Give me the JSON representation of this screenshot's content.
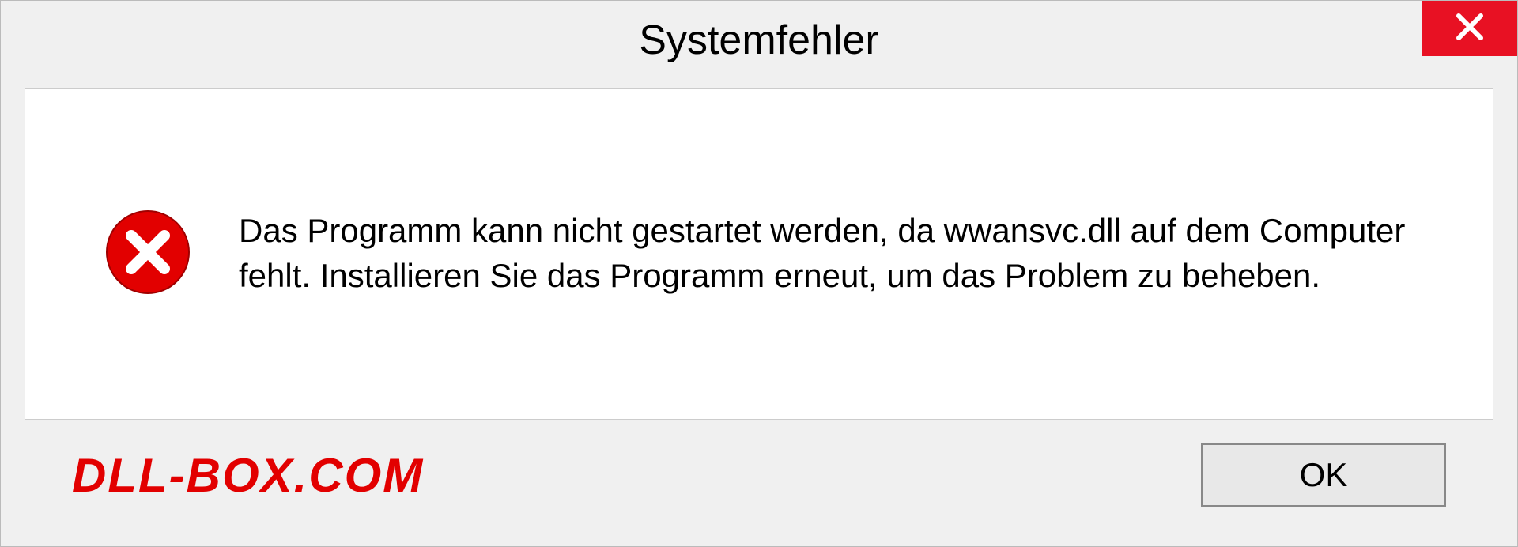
{
  "dialog": {
    "title": "Systemfehler",
    "message": "Das Programm kann nicht gestartet werden, da wwansvc.dll auf dem Computer fehlt. Installieren Sie das Programm erneut, um das Problem zu beheben.",
    "ok_label": "OK"
  },
  "watermark": "DLL-BOX.COM"
}
